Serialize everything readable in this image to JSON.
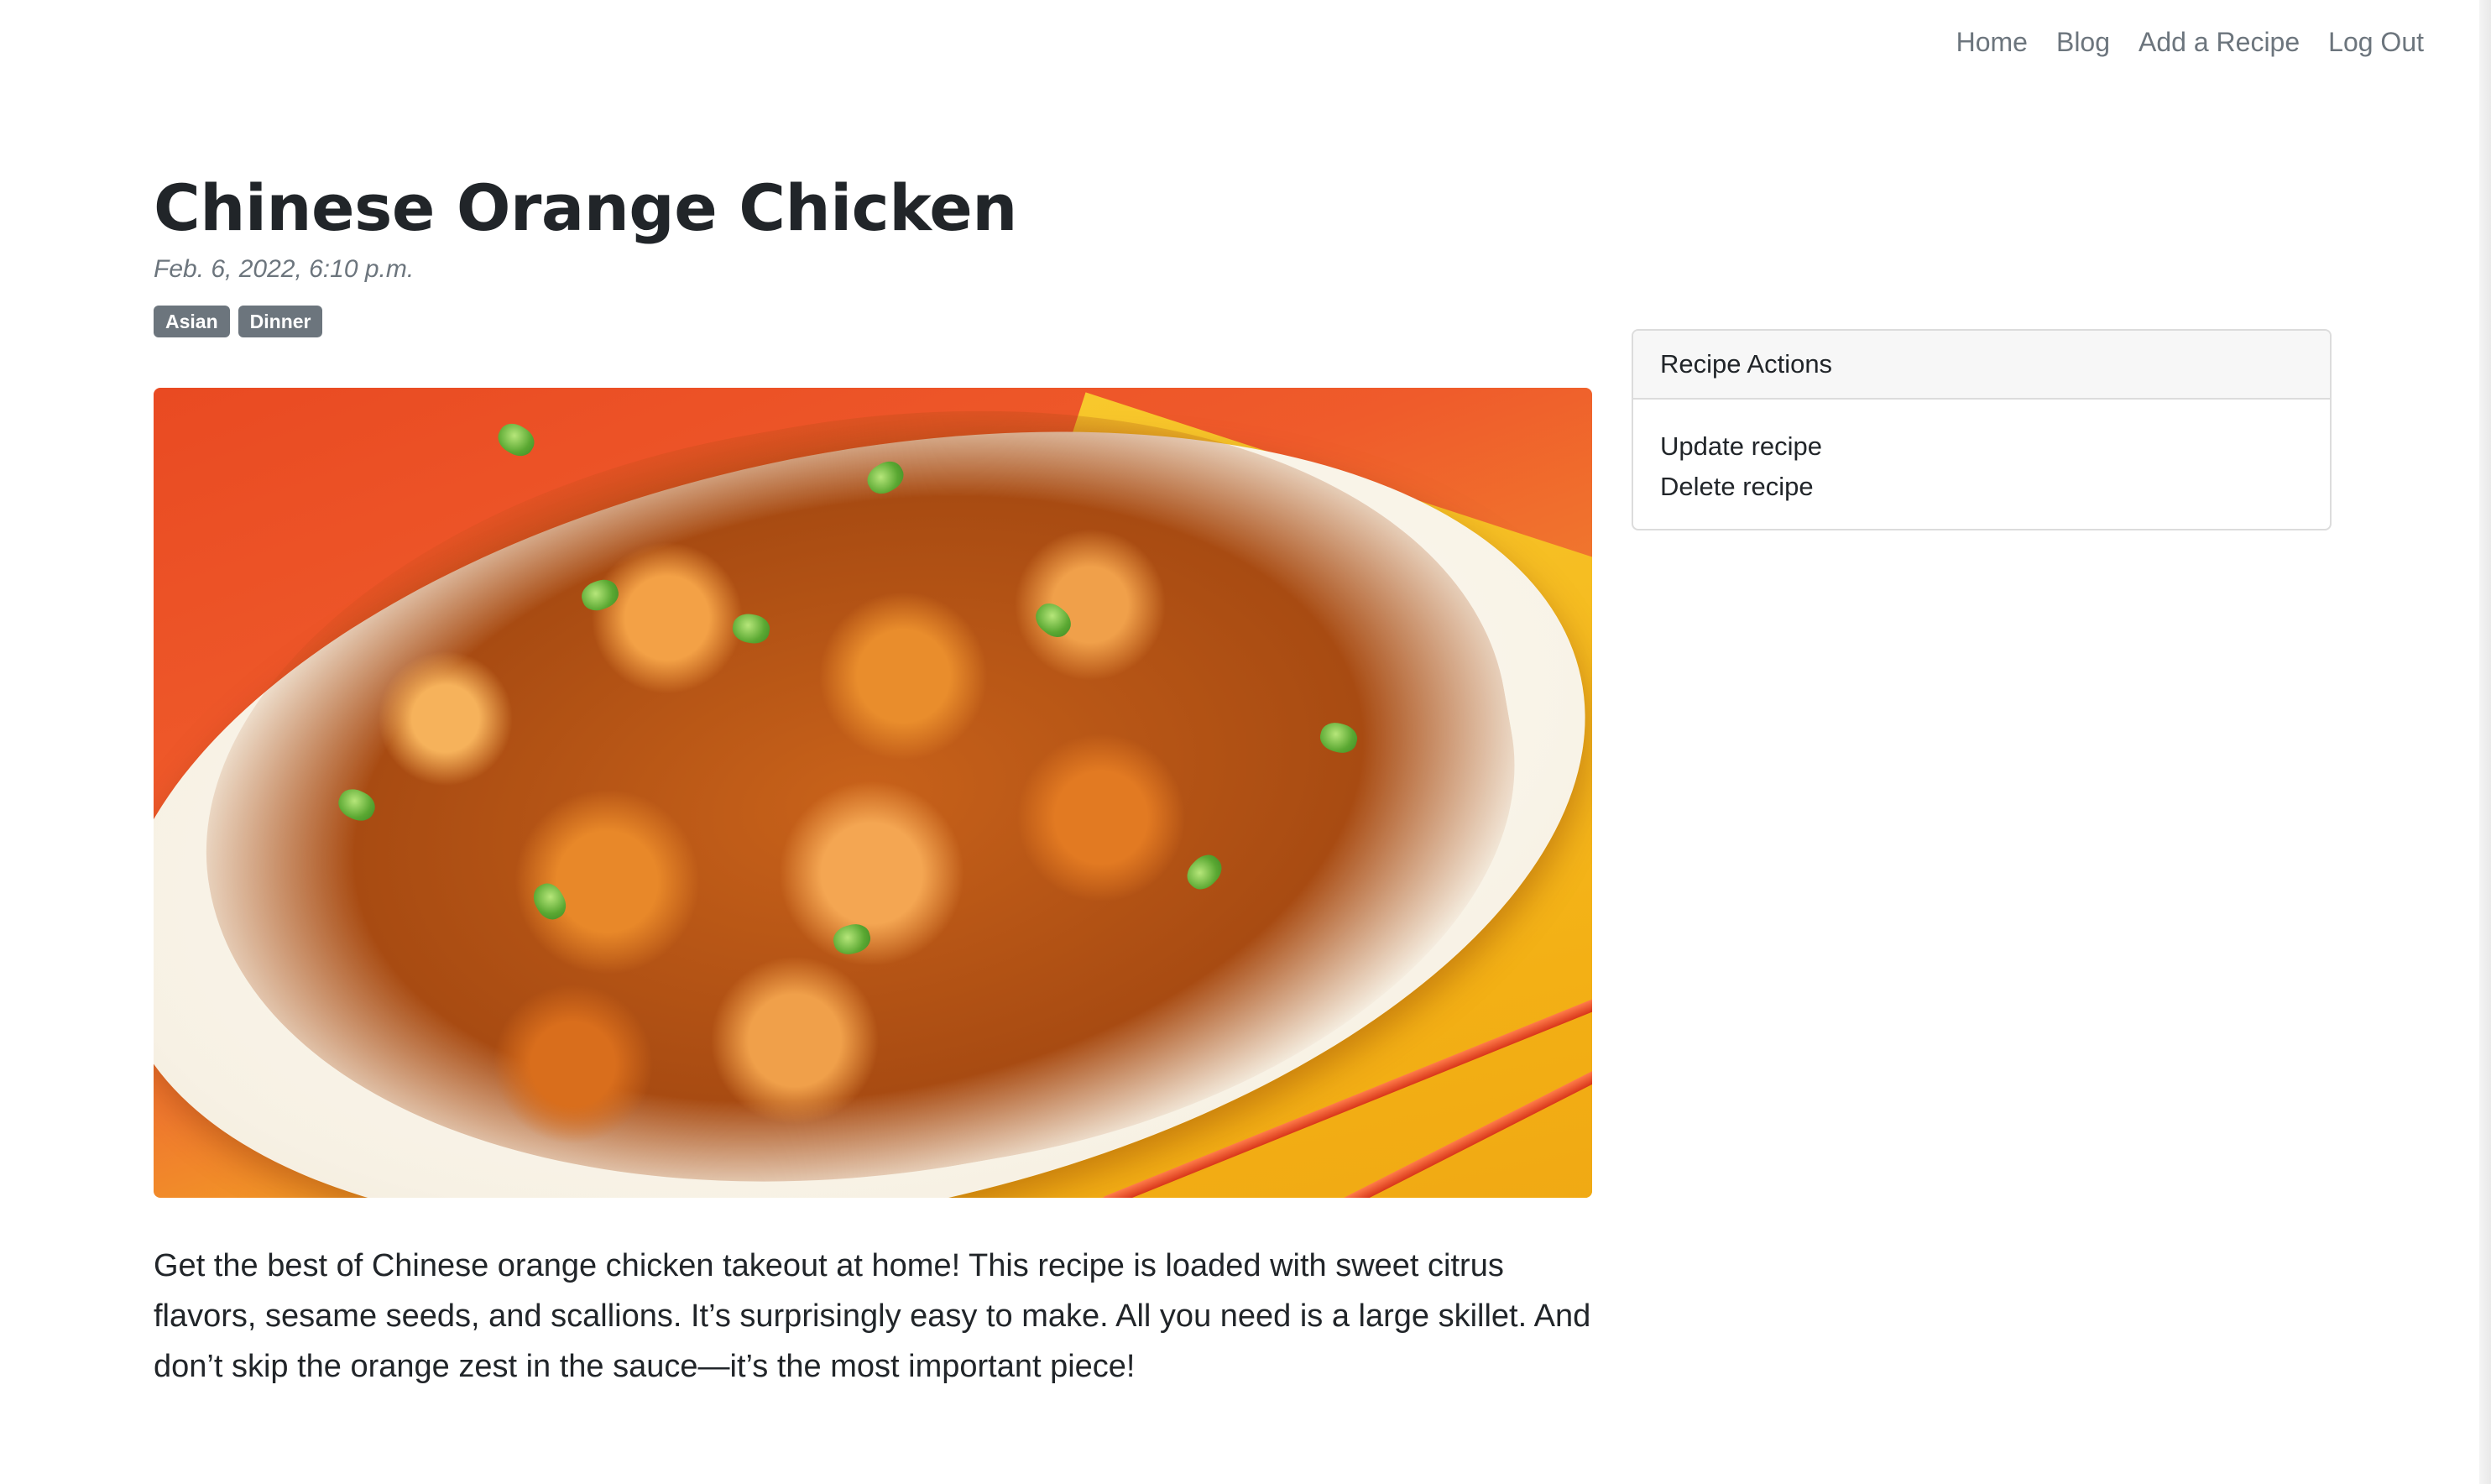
{
  "nav": {
    "links": [
      "Home",
      "Blog",
      "Add a Recipe",
      "Log Out"
    ]
  },
  "recipe": {
    "title": "Chinese Orange Chicken",
    "date": "Feb. 6, 2022, 6:10 p.m.",
    "tags": [
      "Asian",
      "Dinner"
    ],
    "description": "Get the best of Chinese orange chicken takeout at home! This recipe is loaded with sweet citrus flavors, sesame seeds, and scallions. It’s surprisingly easy to make. All you need is a large skillet. And don’t skip the orange zest in the sauce—it’s the most important piece!"
  },
  "sidebar": {
    "header": "Recipe Actions",
    "actions": [
      "Update recipe",
      "Delete recipe"
    ]
  },
  "colors": {
    "nav_text": "#6c757d",
    "tag_bg": "#6c757d",
    "text": "#212529",
    "card_border": "#dcdcdc",
    "card_header_bg": "#f7f7f7"
  }
}
